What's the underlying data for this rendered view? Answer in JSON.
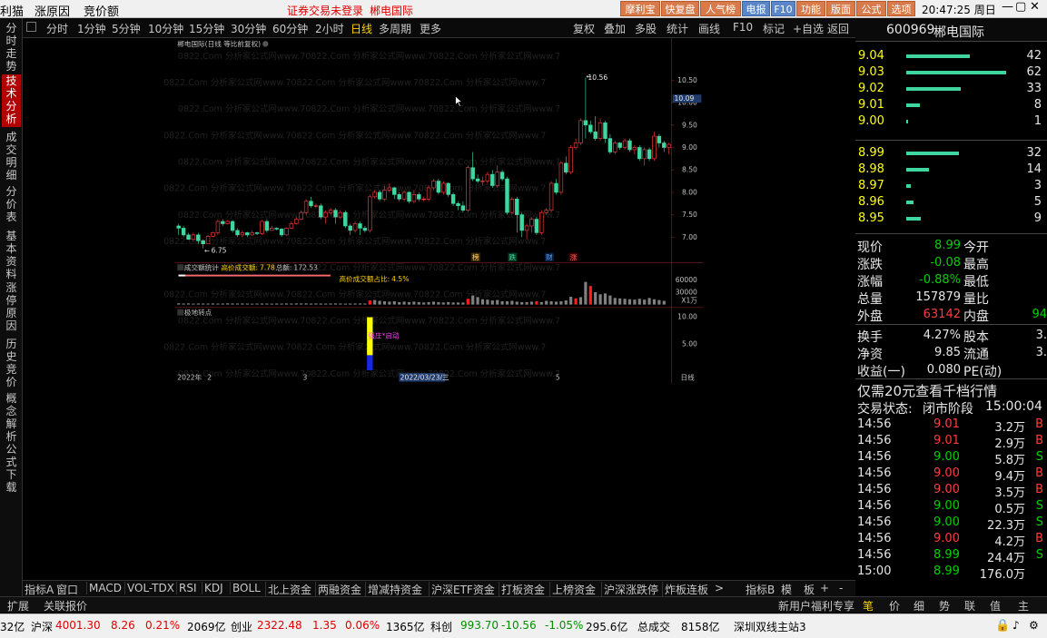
{
  "titlebar": {
    "menu": [
      "利猫",
      "涨原因",
      "竞价额"
    ],
    "notice": "证券交易未登录",
    "stock": "郴电国际",
    "buttons": [
      "摩利宝",
      "快复盘",
      "人气榜",
      "电报",
      "F10",
      "功能",
      "版面",
      "公式",
      "选项"
    ],
    "clock": "20:47:25 周日"
  },
  "sidetabs": [
    "分时走势",
    "技术分析",
    "成交明细",
    "分价表",
    "基本资料",
    "涨停原因",
    "历史竞价",
    "概念解析",
    "公式下载"
  ],
  "periods": [
    "分时",
    "1分钟",
    "5分钟",
    "10分钟",
    "15分钟",
    "30分钟",
    "60分钟",
    "2小时",
    "日线",
    "多周期",
    "更多"
  ],
  "tools": [
    "复权",
    "叠加",
    "多股",
    "统计",
    "画线",
    "F10",
    "标记",
    "+自选",
    "返回"
  ],
  "chart": {
    "title": "郴电国际(日线 等比前复权)",
    "watermark": "0822.Com 分析家公式网www.70822.Com 分析家公式网www.70822.Com 分析家公式网www.7",
    "high_label": "10.56",
    "low_label": "6.75",
    "cur_price": "10.09",
    "price_ticks": [
      "10.50",
      "10.00",
      "9.50",
      "9.00",
      "8.50",
      "8.00",
      "7.50",
      "7.00"
    ],
    "event_labels": [
      "榜",
      "跌",
      "财",
      "涨"
    ]
  },
  "volume": {
    "title": "成交额统计",
    "hi_label": "高价成交额:",
    "hi_value": "7.78",
    "total_label": "总额:",
    "total_value": "172.53",
    "ratio_label": "高价成交额占比:",
    "ratio_value": "4.5%",
    "ticks": [
      "60000",
      "30000",
      "X1万"
    ]
  },
  "pivot": {
    "title": "极地转点",
    "ticks": [
      "10.00",
      "5.00"
    ],
    "signal": "强庄*启动"
  },
  "dates": {
    "d1": "2022年",
    "d2": "2",
    "d3": "3",
    "d4": "2022/03/23/三",
    "d5": "5",
    "period": "日线"
  },
  "bottomtabs": [
    "指标A",
    "窗口",
    "MACD",
    "VOL-TDX",
    "RSI",
    "KDJ",
    "BOLL",
    "北上资金",
    "两融资金",
    "增减持资金",
    "沪深ETF资金",
    "打板资金",
    "上榜资金",
    "沪深涨跌停",
    "炸板连板"
  ],
  "bottom_right": [
    "指标B",
    "模",
    "板"
  ],
  "row2": {
    "left": [
      "扩展",
      "关联报价"
    ],
    "ad": "新用户福利专享",
    "tabs": [
      "笔",
      "价",
      "细",
      "势",
      "联",
      "值",
      "主"
    ]
  },
  "stock": {
    "code": "600969",
    "name": "郴电国际"
  },
  "asks": [
    {
      "p": "9.04",
      "v": "42"
    },
    {
      "p": "9.03",
      "v": "62"
    },
    {
      "p": "9.02",
      "v": "33"
    },
    {
      "p": "9.01",
      "v": "8"
    },
    {
      "p": "9.00",
      "v": "1"
    }
  ],
  "bids": [
    {
      "p": "8.99",
      "v": "32"
    },
    {
      "p": "8.98",
      "v": "14"
    },
    {
      "p": "8.97",
      "v": "3"
    },
    {
      "p": "8.96",
      "v": "5"
    },
    {
      "p": "8.95",
      "v": "9"
    }
  ],
  "quote": [
    {
      "l": "现价",
      "v": "8.99",
      "c": "green",
      "l2": "今开"
    },
    {
      "l": "涨跌",
      "v": "-0.08",
      "c": "green",
      "l2": "最高"
    },
    {
      "l": "涨幅",
      "v": "-0.88%",
      "c": "green",
      "l2": "最低"
    },
    {
      "l": "总量",
      "v": "157879",
      "c": "white",
      "l2": "量比"
    },
    {
      "l": "外盘",
      "v": "63142",
      "c": "red",
      "l2": "内盘",
      "v2": "94"
    }
  ],
  "quote2": [
    {
      "l": "换手",
      "v": "4.27%",
      "l2": "股本",
      "v2": "3."
    },
    {
      "l": "净资",
      "v": "9.85",
      "l2": "流通",
      "v2": "3."
    },
    {
      "l": "收益(一)",
      "v": "0.080",
      "l2": "PE(动)",
      "v2": ""
    }
  ],
  "promo": "仅需20元查看千档行情",
  "trade_state": {
    "label": "交易状态:",
    "state": "闭市阶段",
    "time": "15:00:04"
  },
  "ticks": [
    {
      "t": "14:56",
      "p": "9.01",
      "v": "3.2万",
      "s": "B",
      "c": "red"
    },
    {
      "t": "14:56",
      "p": "9.01",
      "v": "2.9万",
      "s": "B",
      "c": "red"
    },
    {
      "t": "14:56",
      "p": "9.00",
      "v": "5.8万",
      "s": "S",
      "c": "green"
    },
    {
      "t": "14:56",
      "p": "9.00",
      "v": "9.4万",
      "s": "B",
      "c": "red"
    },
    {
      "t": "14:56",
      "p": "9.00",
      "v": "3.5万",
      "s": "B",
      "c": "red"
    },
    {
      "t": "14:56",
      "p": "9.00",
      "v": "0.5万",
      "s": "S",
      "c": "green"
    },
    {
      "t": "14:56",
      "p": "9.00",
      "v": "22.3万",
      "s": "S",
      "c": "green"
    },
    {
      "t": "14:56",
      "p": "9.00",
      "v": "4.2万",
      "s": "B",
      "c": "red"
    },
    {
      "t": "14:56",
      "p": "8.99",
      "v": "24.4万",
      "s": "S",
      "c": "green"
    },
    {
      "t": "15:00",
      "p": "8.99",
      "v": "176.0万",
      "s": "",
      "c": "green"
    }
  ],
  "status": {
    "s0": "32亿",
    "sh": "沪深",
    "sh_v": "4001.30",
    "sh_c": "8.26",
    "sh_p": "0.21%",
    "sh_a": "2069亿",
    "cy": "创业",
    "cy_v": "2322.48",
    "cy_c": "1.35",
    "cy_p": "0.06%",
    "cy_a": "1365亿",
    "kc": "科创",
    "kc_v": "993.70",
    "kc_c": "-10.56",
    "kc_p": "-1.05%",
    "kc_a": "295.6亿",
    "zcj": "总成交",
    "zcj_v": "8158亿",
    "site": "深圳双线主站3"
  },
  "chart_data": {
    "type": "candlestick",
    "ylim": [
      6.6,
      10.9
    ],
    "candles": [
      [
        7.25,
        7.2,
        7.3,
        7.05
      ],
      [
        7.2,
        7.05,
        7.25,
        7.0
      ],
      [
        7.05,
        6.95,
        7.1,
        6.95
      ],
      [
        6.95,
        7.05,
        7.1,
        6.9
      ],
      [
        7.05,
        6.92,
        7.1,
        6.85
      ],
      [
        6.92,
        6.85,
        6.95,
        6.75
      ],
      [
        6.85,
        7.02,
        7.05,
        6.85
      ],
      [
        7.02,
        7.1,
        7.12,
        7.0
      ],
      [
        7.1,
        7.35,
        7.4,
        7.05
      ],
      [
        7.35,
        7.3,
        7.4,
        7.25
      ],
      [
        7.3,
        7.35,
        7.38,
        7.28
      ],
      [
        7.35,
        7.15,
        7.38,
        7.1
      ],
      [
        7.15,
        7.05,
        7.2,
        7.0
      ],
      [
        7.05,
        7.1,
        7.15,
        7.0
      ],
      [
        7.1,
        7.05,
        7.12,
        7.0
      ],
      [
        7.05,
        7.1,
        7.15,
        7.03
      ],
      [
        7.1,
        7.08,
        7.12,
        7.05
      ],
      [
        7.08,
        7.35,
        7.38,
        7.05
      ],
      [
        7.35,
        7.15,
        7.4,
        7.1
      ],
      [
        7.15,
        7.2,
        7.25,
        7.15
      ],
      [
        7.2,
        7.18,
        7.22,
        7.15
      ],
      [
        7.18,
        7.05,
        7.2,
        7.0
      ],
      [
        7.05,
        7.2,
        7.22,
        7.03
      ],
      [
        7.2,
        7.3,
        7.35,
        7.18
      ],
      [
        7.3,
        7.4,
        7.45,
        7.28
      ],
      [
        7.4,
        7.55,
        7.6,
        7.38
      ],
      [
        7.55,
        7.8,
        7.85,
        7.5
      ],
      [
        7.8,
        7.7,
        7.9,
        7.65
      ],
      [
        7.7,
        7.7,
        7.75,
        7.65
      ],
      [
        7.7,
        7.45,
        7.75,
        7.4
      ],
      [
        7.45,
        7.55,
        7.6,
        7.3
      ],
      [
        7.55,
        7.6,
        7.65,
        7.5
      ],
      [
        7.6,
        7.45,
        7.65,
        7.3
      ],
      [
        7.45,
        7.55,
        7.6,
        7.4
      ],
      [
        7.55,
        7.25,
        7.6,
        7.2
      ],
      [
        7.25,
        7.15,
        7.3,
        7.05
      ],
      [
        7.15,
        7.3,
        7.35,
        7.1
      ],
      [
        7.3,
        7.2,
        7.35,
        7.05
      ],
      [
        7.2,
        7.15,
        7.25,
        7.1
      ],
      [
        7.15,
        7.9,
        7.95,
        7.1
      ],
      [
        7.9,
        8.0,
        8.05,
        7.85
      ],
      [
        8.0,
        7.85,
        8.05,
        7.8
      ],
      [
        7.85,
        8.05,
        8.15,
        7.8
      ],
      [
        8.05,
        8.1,
        8.2,
        8.0
      ],
      [
        8.1,
        7.95,
        8.12,
        7.85
      ],
      [
        7.95,
        7.85,
        8.0,
        7.8
      ],
      [
        7.85,
        8.0,
        8.05,
        7.8
      ],
      [
        8.0,
        7.8,
        8.02,
        7.75
      ],
      [
        7.8,
        7.95,
        8.05,
        7.75
      ],
      [
        7.95,
        7.85,
        8.0,
        7.8
      ],
      [
        7.85,
        7.85,
        7.9,
        7.8
      ],
      [
        7.85,
        8.1,
        8.15,
        7.8
      ],
      [
        8.1,
        8.25,
        8.3,
        8.05
      ],
      [
        8.25,
        8.0,
        8.3,
        7.95
      ],
      [
        8.0,
        8.2,
        8.25,
        7.95
      ],
      [
        8.2,
        7.95,
        8.22,
        7.9
      ],
      [
        7.95,
        7.75,
        8.0,
        7.7
      ],
      [
        7.75,
        7.7,
        7.8,
        7.6
      ],
      [
        7.7,
        7.6,
        7.8,
        7.55
      ],
      [
        7.6,
        8.55,
        8.6,
        7.55
      ],
      [
        8.55,
        8.3,
        8.9,
        8.25
      ],
      [
        8.3,
        8.25,
        8.4,
        8.2
      ],
      [
        8.25,
        8.25,
        8.35,
        8.15
      ],
      [
        8.25,
        8.4,
        8.45,
        8.2
      ],
      [
        8.4,
        8.15,
        8.5,
        8.1
      ],
      [
        8.15,
        8.45,
        8.6,
        8.1
      ],
      [
        8.45,
        8.3,
        8.5,
        8.25
      ],
      [
        8.3,
        7.55,
        8.35,
        7.5
      ],
      [
        7.55,
        7.85,
        7.9,
        7.5
      ],
      [
        7.85,
        7.5,
        7.9,
        7.1
      ],
      [
        7.5,
        7.15,
        7.55,
        7.0
      ],
      [
        7.15,
        7.25,
        7.3,
        6.95
      ],
      [
        7.25,
        7.4,
        7.45,
        7.1
      ],
      [
        7.4,
        7.1,
        7.45,
        7.05
      ],
      [
        7.1,
        7.55,
        7.6,
        7.05
      ],
      [
        7.55,
        7.6,
        7.65,
        7.5
      ],
      [
        7.6,
        8.2,
        8.25,
        7.55
      ],
      [
        8.2,
        8.0,
        8.3,
        7.95
      ],
      [
        8.0,
        8.65,
        8.7,
        7.95
      ],
      [
        8.65,
        8.45,
        8.8,
        8.4
      ],
      [
        8.45,
        9.0,
        9.05,
        8.4
      ],
      [
        9.0,
        9.1,
        9.2,
        8.95
      ],
      [
        9.1,
        9.6,
        9.65,
        9.05
      ],
      [
        9.6,
        9.5,
        10.56,
        9.2
      ],
      [
        9.5,
        9.35,
        9.6,
        9.3
      ],
      [
        9.35,
        9.2,
        9.7,
        9.15
      ],
      [
        9.2,
        9.55,
        9.65,
        9.15
      ],
      [
        9.55,
        9.2,
        9.6,
        9.1
      ],
      [
        9.2,
        8.9,
        9.3,
        8.85
      ],
      [
        8.9,
        9.1,
        9.15,
        8.85
      ],
      [
        9.1,
        9.0,
        9.12,
        8.95
      ],
      [
        9.0,
        9.15,
        9.2,
        8.95
      ],
      [
        9.15,
        8.95,
        9.2,
        8.9
      ],
      [
        8.95,
        9.0,
        9.05,
        8.85
      ],
      [
        9.0,
        8.75,
        9.05,
        8.7
      ],
      [
        8.75,
        8.95,
        9.0,
        8.6
      ],
      [
        8.95,
        8.75,
        9.0,
        8.7
      ],
      [
        8.75,
        9.25,
        9.35,
        8.7
      ],
      [
        9.25,
        9.1,
        9.3,
        9.0
      ],
      [
        9.1,
        9.0,
        9.15,
        8.9
      ],
      [
        9.0,
        9.07,
        9.1,
        8.85
      ]
    ],
    "volume": [
      3,
      2.5,
      2.8,
      2.2,
      2.6,
      2.4,
      2.5,
      2.7,
      2.3,
      2.5,
      3,
      2.6,
      2.4,
      2.7,
      2.5,
      2.2,
      2.4,
      2.6,
      2.5,
      2.3,
      2.6,
      2.4,
      2.7,
      2.5,
      2.8,
      2.6,
      2.9,
      2.5,
      2.7,
      2.6,
      2.4,
      2.5,
      2.8,
      2.6,
      2.4,
      2.5,
      2.7,
      2.6,
      2.5,
      10,
      11,
      9,
      8,
      7,
      8,
      6,
      7,
      6,
      7,
      6,
      5,
      6,
      7,
      6,
      5,
      6,
      5,
      5,
      5,
      14,
      22,
      18,
      13,
      12,
      10,
      11,
      8,
      8,
      9,
      7,
      6,
      6,
      7,
      8,
      6,
      9,
      8,
      7,
      8,
      10,
      19,
      15,
      18,
      55,
      45,
      30,
      25,
      27,
      22,
      16,
      15,
      14,
      13,
      12,
      14,
      12,
      16,
      13,
      11,
      9
    ]
  }
}
